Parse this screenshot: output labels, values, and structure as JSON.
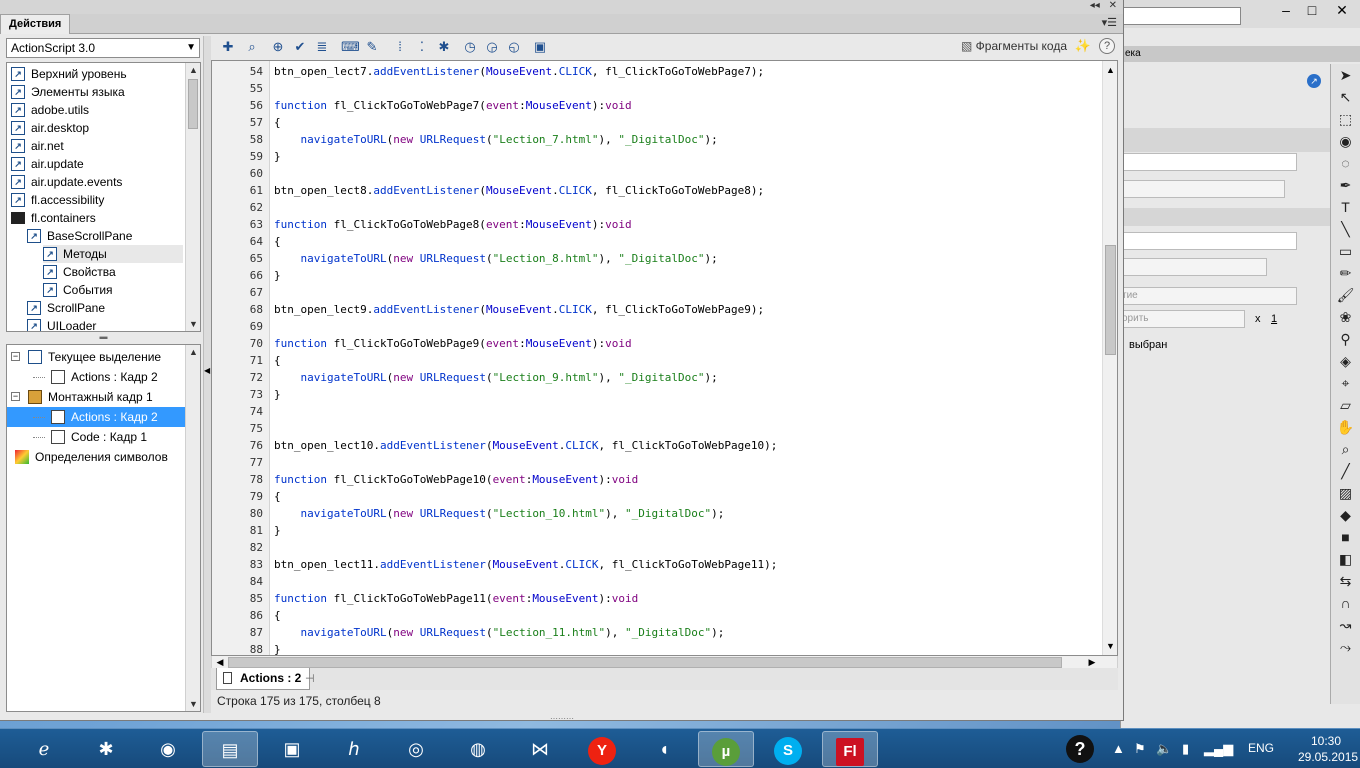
{
  "window": {
    "panel_title": "Действия",
    "minimize_glyph": "◂◂",
    "close_glyph": "✕"
  },
  "language_select": {
    "value": "ActionScript 3.0"
  },
  "library": {
    "items": [
      {
        "label": "Верхний уровень",
        "kind": "book"
      },
      {
        "label": "Элементы языка",
        "kind": "book"
      },
      {
        "label": "adobe.utils",
        "kind": "book"
      },
      {
        "label": "air.desktop",
        "kind": "book"
      },
      {
        "label": "air.net",
        "kind": "book"
      },
      {
        "label": "air.update",
        "kind": "book"
      },
      {
        "label": "air.update.events",
        "kind": "book"
      },
      {
        "label": "fl.accessibility",
        "kind": "book"
      },
      {
        "label": "fl.containers",
        "kind": "folder"
      },
      {
        "label": "BaseScrollPane",
        "kind": "book"
      },
      {
        "label": "Методы",
        "kind": "book"
      },
      {
        "label": "Свойства",
        "kind": "book"
      },
      {
        "label": "События",
        "kind": "book"
      },
      {
        "label": "ScrollPane",
        "kind": "book"
      },
      {
        "label": "UILoader",
        "kind": "book"
      }
    ]
  },
  "script_tree": {
    "items": [
      {
        "label": "Текущее выделение",
        "expander": "−"
      },
      {
        "label": "Actions : Кадр 2",
        "expander": ""
      },
      {
        "label": "Монтажный кадр 1",
        "expander": "−"
      },
      {
        "label": "Actions : Кадр 2",
        "expander": "",
        "selected": true
      },
      {
        "label": "Code : Кадр 1",
        "expander": ""
      },
      {
        "label": "Определения символов",
        "expander": ""
      }
    ]
  },
  "toolbar": {
    "snippets_label": "Фрагменты кода",
    "help_label": "?"
  },
  "editor": {
    "lines": [
      {
        "n": "54",
        "parts": [
          [
            "btn_open_lect7.",
            ""
          ],
          [
            "addEventListener",
            "kw"
          ],
          [
            "(",
            ""
          ],
          [
            "MouseEvent",
            "cls"
          ],
          [
            ".",
            ""
          ],
          [
            "CLICK",
            "kw"
          ],
          [
            ", fl_ClickToGoToWebPage7);",
            ""
          ]
        ]
      },
      {
        "n": "55",
        "parts": []
      },
      {
        "n": "56",
        "parts": [
          [
            "function",
            "kw"
          ],
          [
            " fl_ClickToGoToWebPage7(",
            ""
          ],
          [
            "event",
            "pu"
          ],
          [
            ":",
            ""
          ],
          [
            "MouseEvent",
            "cls"
          ],
          [
            "):",
            ""
          ],
          [
            "void",
            "pu"
          ]
        ]
      },
      {
        "n": "57",
        "parts": [
          [
            "{",
            ""
          ]
        ]
      },
      {
        "n": "58",
        "parts": [
          [
            "    ",
            ""
          ],
          [
            "navigateToURL",
            "kw"
          ],
          [
            "(",
            ""
          ],
          [
            "new",
            "pu"
          ],
          [
            " ",
            ""
          ],
          [
            "URLRequest",
            "kw"
          ],
          [
            "(",
            ""
          ],
          [
            "\"Lection_7.html\"",
            "st"
          ],
          [
            "), ",
            ""
          ],
          [
            "\"_DigitalDoc\"",
            "st"
          ],
          [
            ");",
            ""
          ]
        ]
      },
      {
        "n": "59",
        "parts": [
          [
            "}",
            ""
          ]
        ]
      },
      {
        "n": "60",
        "parts": []
      },
      {
        "n": "61",
        "parts": [
          [
            "btn_open_lect8.",
            ""
          ],
          [
            "addEventListener",
            "kw"
          ],
          [
            "(",
            ""
          ],
          [
            "MouseEvent",
            "cls"
          ],
          [
            ".",
            ""
          ],
          [
            "CLICK",
            "kw"
          ],
          [
            ", fl_ClickToGoToWebPage8);",
            ""
          ]
        ]
      },
      {
        "n": "62",
        "parts": []
      },
      {
        "n": "63",
        "parts": [
          [
            "function",
            "kw"
          ],
          [
            " fl_ClickToGoToWebPage8(",
            ""
          ],
          [
            "event",
            "pu"
          ],
          [
            ":",
            ""
          ],
          [
            "MouseEvent",
            "cls"
          ],
          [
            "):",
            ""
          ],
          [
            "void",
            "pu"
          ]
        ]
      },
      {
        "n": "64",
        "parts": [
          [
            "{",
            ""
          ]
        ]
      },
      {
        "n": "65",
        "parts": [
          [
            "    ",
            ""
          ],
          [
            "navigateToURL",
            "kw"
          ],
          [
            "(",
            ""
          ],
          [
            "new",
            "pu"
          ],
          [
            " ",
            ""
          ],
          [
            "URLRequest",
            "kw"
          ],
          [
            "(",
            ""
          ],
          [
            "\"Lection_8.html\"",
            "st"
          ],
          [
            "), ",
            ""
          ],
          [
            "\"_DigitalDoc\"",
            "st"
          ],
          [
            ");",
            ""
          ]
        ]
      },
      {
        "n": "66",
        "parts": [
          [
            "}",
            ""
          ]
        ]
      },
      {
        "n": "67",
        "parts": []
      },
      {
        "n": "68",
        "parts": [
          [
            "btn_open_lect9.",
            ""
          ],
          [
            "addEventListener",
            "kw"
          ],
          [
            "(",
            ""
          ],
          [
            "MouseEvent",
            "cls"
          ],
          [
            ".",
            ""
          ],
          [
            "CLICK",
            "kw"
          ],
          [
            ", fl_ClickToGoToWebPage9);",
            ""
          ]
        ]
      },
      {
        "n": "69",
        "parts": []
      },
      {
        "n": "70",
        "parts": [
          [
            "function",
            "kw"
          ],
          [
            " fl_ClickToGoToWebPage9(",
            ""
          ],
          [
            "event",
            "pu"
          ],
          [
            ":",
            ""
          ],
          [
            "MouseEvent",
            "cls"
          ],
          [
            "):",
            ""
          ],
          [
            "void",
            "pu"
          ]
        ]
      },
      {
        "n": "71",
        "parts": [
          [
            "{",
            ""
          ]
        ]
      },
      {
        "n": "72",
        "parts": [
          [
            "    ",
            ""
          ],
          [
            "navigateToURL",
            "kw"
          ],
          [
            "(",
            ""
          ],
          [
            "new",
            "pu"
          ],
          [
            " ",
            ""
          ],
          [
            "URLRequest",
            "kw"
          ],
          [
            "(",
            ""
          ],
          [
            "\"Lection_9.html\"",
            "st"
          ],
          [
            "), ",
            ""
          ],
          [
            "\"_DigitalDoc\"",
            "st"
          ],
          [
            ");",
            ""
          ]
        ]
      },
      {
        "n": "73",
        "parts": [
          [
            "}",
            ""
          ]
        ]
      },
      {
        "n": "74",
        "parts": []
      },
      {
        "n": "75",
        "parts": []
      },
      {
        "n": "76",
        "parts": [
          [
            "btn_open_lect10.",
            ""
          ],
          [
            "addEventListener",
            "kw"
          ],
          [
            "(",
            ""
          ],
          [
            "MouseEvent",
            "cls"
          ],
          [
            ".",
            ""
          ],
          [
            "CLICK",
            "kw"
          ],
          [
            ", fl_ClickToGoToWebPage10);",
            ""
          ]
        ]
      },
      {
        "n": "77",
        "parts": []
      },
      {
        "n": "78",
        "parts": [
          [
            "function",
            "kw"
          ],
          [
            " fl_ClickToGoToWebPage10(",
            ""
          ],
          [
            "event",
            "pu"
          ],
          [
            ":",
            ""
          ],
          [
            "MouseEvent",
            "cls"
          ],
          [
            "):",
            ""
          ],
          [
            "void",
            "pu"
          ]
        ]
      },
      {
        "n": "79",
        "parts": [
          [
            "{",
            ""
          ]
        ]
      },
      {
        "n": "80",
        "parts": [
          [
            "    ",
            ""
          ],
          [
            "navigateToURL",
            "kw"
          ],
          [
            "(",
            ""
          ],
          [
            "new",
            "pu"
          ],
          [
            " ",
            ""
          ],
          [
            "URLRequest",
            "kw"
          ],
          [
            "(",
            ""
          ],
          [
            "\"Lection_10.html\"",
            "st"
          ],
          [
            "), ",
            ""
          ],
          [
            "\"_DigitalDoc\"",
            "st"
          ],
          [
            ");",
            ""
          ]
        ]
      },
      {
        "n": "81",
        "parts": [
          [
            "}",
            ""
          ]
        ]
      },
      {
        "n": "82",
        "parts": []
      },
      {
        "n": "83",
        "parts": [
          [
            "btn_open_lect11.",
            ""
          ],
          [
            "addEventListener",
            "kw"
          ],
          [
            "(",
            ""
          ],
          [
            "MouseEvent",
            "cls"
          ],
          [
            ".",
            ""
          ],
          [
            "CLICK",
            "kw"
          ],
          [
            ", fl_ClickToGoToWebPage11);",
            ""
          ]
        ]
      },
      {
        "n": "84",
        "parts": []
      },
      {
        "n": "85",
        "parts": [
          [
            "function",
            "kw"
          ],
          [
            " fl_ClickToGoToWebPage11(",
            ""
          ],
          [
            "event",
            "pu"
          ],
          [
            ":",
            ""
          ],
          [
            "MouseEvent",
            "cls"
          ],
          [
            "):",
            ""
          ],
          [
            "void",
            "pu"
          ]
        ]
      },
      {
        "n": "86",
        "parts": [
          [
            "{",
            ""
          ]
        ]
      },
      {
        "n": "87",
        "parts": [
          [
            "    ",
            ""
          ],
          [
            "navigateToURL",
            "kw"
          ],
          [
            "(",
            ""
          ],
          [
            "new",
            "pu"
          ],
          [
            " ",
            ""
          ],
          [
            "URLRequest",
            "kw"
          ],
          [
            "(",
            ""
          ],
          [
            "\"Lection_11.html\"",
            "st"
          ],
          [
            "), ",
            ""
          ],
          [
            "\"_DigitalDoc\"",
            "st"
          ],
          [
            ");",
            ""
          ]
        ]
      },
      {
        "n": "88",
        "parts": [
          [
            "}",
            ""
          ]
        ]
      }
    ]
  },
  "script_tab": {
    "label": "Actions : 2"
  },
  "status_bar": {
    "text": "Строка 175 из 175, столбец 8"
  },
  "properties_panel": {
    "tab_partial": "ека",
    "field_partial_1": "тие",
    "field_partial_2": "орить",
    "x_label": "x",
    "x_value": "1",
    "note_partial": "выбран"
  },
  "taskbar": {
    "apps": [
      "ie-icon",
      "puzzle-app-icon",
      "media-player-icon",
      "file-explorer-icon",
      "presentation-icon",
      "hp-icon",
      "chrome-icon",
      "chrome-canary-icon",
      "visual-studio-icon",
      "yandex-browser-icon",
      "speaker-app-icon",
      "utorrent-icon",
      "skype-icon",
      "flash-icon"
    ],
    "lang": "ENG",
    "time": "10:30",
    "date": "29.05.2015"
  },
  "colors": {
    "selection": "#3399ff",
    "keyword": "#0033cc",
    "string": "#1a7f1a",
    "purple": "#7f007f"
  }
}
